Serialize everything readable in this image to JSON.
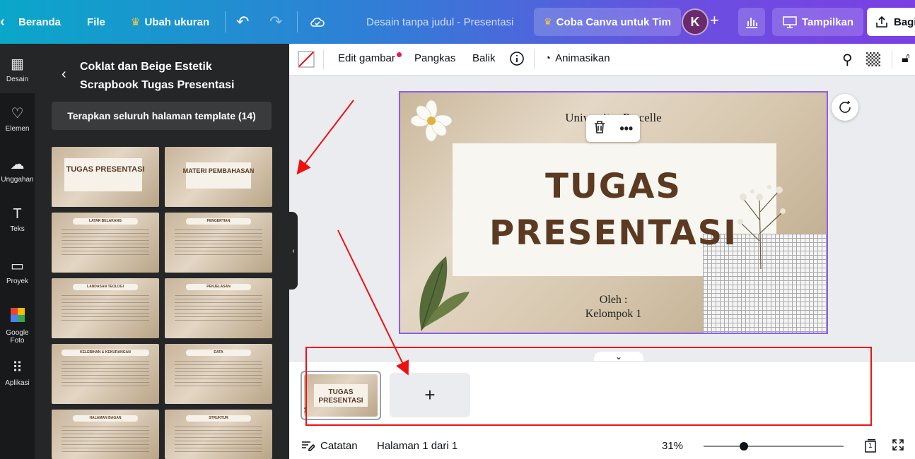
{
  "topbar": {
    "home": "Beranda",
    "file": "File",
    "resize": "Ubah ukuran",
    "doc_title": "Desain tanpa judul - Presentasi",
    "try_team": "Coba Canva untuk Tim",
    "avatar_initial": "K",
    "present": "Tampilkan",
    "share": "Bagi"
  },
  "rail": {
    "items": [
      {
        "label": "Desain",
        "icon": "layout-icon"
      },
      {
        "label": "Elemen",
        "icon": "shapes-icon"
      },
      {
        "label": "Unggahan",
        "icon": "upload-icon"
      },
      {
        "label": "Teks",
        "icon": "text-icon"
      },
      {
        "label": "Proyek",
        "icon": "folder-icon"
      },
      {
        "label": "Google Foto",
        "icon": "google-photos-icon"
      },
      {
        "label": "Aplikasi",
        "icon": "apps-icon"
      }
    ]
  },
  "panel": {
    "title": "Coklat dan Beige Estetik Scrapbook Tugas Presentasi",
    "apply_button": "Terapkan seluruh halaman template (14)",
    "thumbs": [
      {
        "title": "TUGAS PRESENTASI"
      },
      {
        "title": "MATERI PEMBAHASAN"
      },
      {
        "title": "LATAR BELAKANG"
      },
      {
        "title": "PENGERTIAN"
      },
      {
        "title": "LANDASAN TEOLOGI"
      },
      {
        "title": "PENJELASAN"
      },
      {
        "title": "KELEBIHAN & KEKURANGAN"
      },
      {
        "title": "DATA"
      },
      {
        "title": "HALAMAN BAGAN"
      },
      {
        "title": "STRUKTUR"
      }
    ]
  },
  "context_toolbar": {
    "edit_image": "Edit gambar",
    "crop": "Pangkas",
    "flip": "Balik",
    "animate": "Animasikan"
  },
  "slide": {
    "university": "Universitas Parcelle",
    "title_line1": "TUGAS",
    "title_line2": "PRESENTASI",
    "by": "Oleh :",
    "group": "Kelompok 1"
  },
  "pages": {
    "current_number": "1",
    "add_symbol": "+"
  },
  "bottom_bar": {
    "notes": "Catatan",
    "page_indicator": "Halaman 1 dari 1",
    "zoom": "31%",
    "zoom_value": 31,
    "page_count": "1"
  },
  "colors": {
    "selection": "#8b5cf6",
    "annotation": "#e11111",
    "title_brown": "#5b3a21"
  }
}
